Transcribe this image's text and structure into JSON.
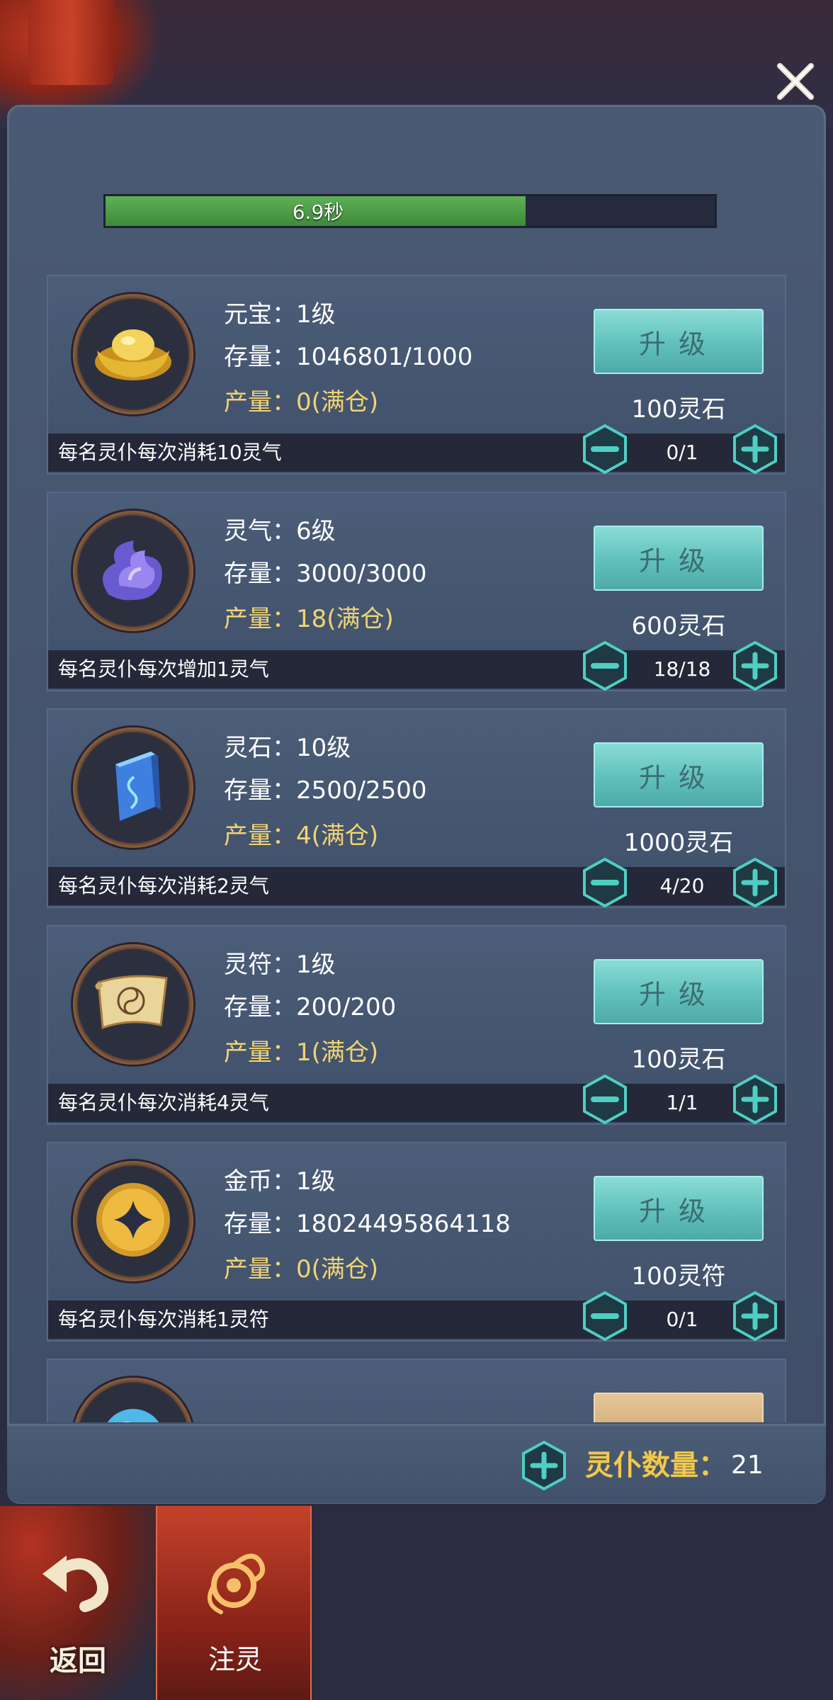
{
  "progress": {
    "label": "6.9秒",
    "fraction": 0.69
  },
  "resources": [
    {
      "icon": "gold-ingot-icon",
      "name": "元宝：1级",
      "stock": "存量：1046801/1000",
      "production": "产量：0(满仓)",
      "upgrade_label": "升级",
      "cost": "100灵石",
      "consume_desc": "每名灵仆每次消耗10灵气",
      "workers": "0/1"
    },
    {
      "icon": "spirit-qi-icon",
      "name": "灵气：6级",
      "stock": "存量：3000/3000",
      "production": "产量：18(满仓)",
      "upgrade_label": "升级",
      "cost": "600灵石",
      "consume_desc": "每名灵仆每次增加1灵气",
      "workers": "18/18"
    },
    {
      "icon": "spirit-stone-icon",
      "name": "灵石：10级",
      "stock": "存量：2500/2500",
      "production": "产量：4(满仓)",
      "upgrade_label": "升级",
      "cost": "1000灵石",
      "consume_desc": "每名灵仆每次消耗2灵气",
      "workers": "4/20"
    },
    {
      "icon": "talisman-scroll-icon",
      "name": "灵符：1级",
      "stock": "存量：200/200",
      "production": "产量：1(满仓)",
      "upgrade_label": "升级",
      "cost": "100灵石",
      "consume_desc": "每名灵仆每次消耗4灵气",
      "workers": "1/1"
    },
    {
      "icon": "gold-coin-icon",
      "name": "金币：1级",
      "stock": "存量：18024495864118",
      "production": "产量：0(满仓)",
      "upgrade_label": "升级",
      "cost": "100灵符",
      "consume_desc": "每名灵仆每次消耗1灵符",
      "workers": "0/1"
    }
  ],
  "summary": {
    "label": "灵仆数量：",
    "value": "21"
  },
  "nav": {
    "back_label": "返回",
    "zhuling_label": "注灵"
  },
  "colors": {
    "accent_teal": "#5fc0bc",
    "production_gold": "#f1d472",
    "progress_green": "#4f9e48"
  }
}
